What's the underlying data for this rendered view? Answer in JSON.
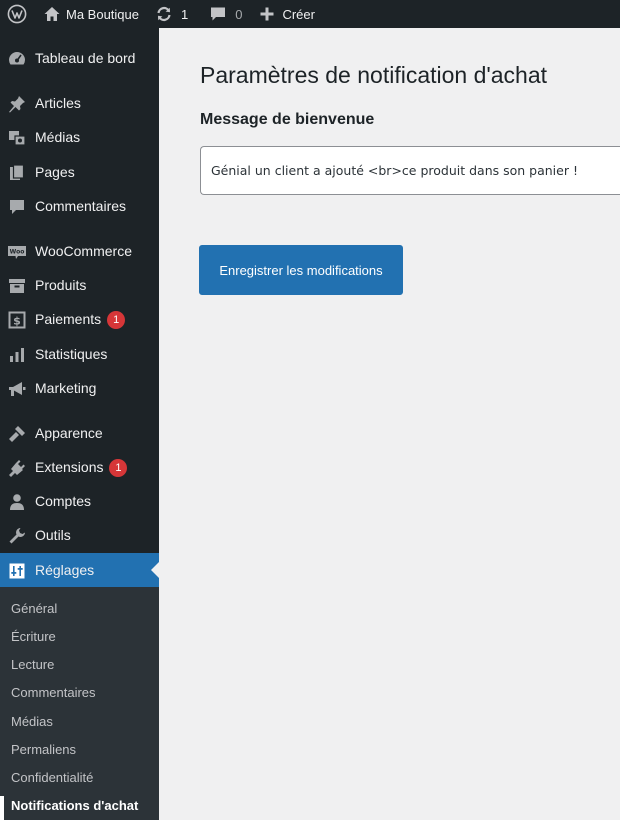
{
  "admin_bar": {
    "site_name": "Ma Boutique",
    "updates_count": "1",
    "comments_count": "0",
    "new_label": "Créer"
  },
  "sidebar": {
    "items": [
      {
        "label": "Tableau de bord",
        "icon": "dashboard-icon"
      },
      {
        "label": "Articles",
        "icon": "pin-icon"
      },
      {
        "label": "Médias",
        "icon": "media-icon"
      },
      {
        "label": "Pages",
        "icon": "pages-icon"
      },
      {
        "label": "Commentaires",
        "icon": "comments-icon"
      },
      {
        "label": "WooCommerce",
        "icon": "woocommerce-icon"
      },
      {
        "label": "Produits",
        "icon": "products-icon"
      },
      {
        "label": "Paiements",
        "icon": "payments-icon",
        "badge": "1"
      },
      {
        "label": "Statistiques",
        "icon": "stats-icon"
      },
      {
        "label": "Marketing",
        "icon": "megaphone-icon"
      },
      {
        "label": "Apparence",
        "icon": "brush-icon"
      },
      {
        "label": "Extensions",
        "icon": "plugin-icon",
        "badge": "1"
      },
      {
        "label": "Comptes",
        "icon": "user-icon"
      },
      {
        "label": "Outils",
        "icon": "wrench-icon"
      },
      {
        "label": "Réglages",
        "icon": "settings-icon",
        "active": true
      }
    ],
    "submenu": [
      {
        "label": "Général"
      },
      {
        "label": "Écriture"
      },
      {
        "label": "Lecture"
      },
      {
        "label": "Commentaires"
      },
      {
        "label": "Médias"
      },
      {
        "label": "Permaliens"
      },
      {
        "label": "Confidentialité"
      },
      {
        "label": "Notifications d'achat",
        "current": true
      }
    ]
  },
  "main": {
    "title": "Paramètres de notification d'achat",
    "field_label": "Message de bienvenue",
    "field_value": "Génial un client a ajouté <br>ce produit dans son panier !",
    "save_label": "Enregistrer les modifications"
  },
  "colors": {
    "admin_dark": "#1d2327",
    "submenu_bg": "#2c3338",
    "accent": "#2271b1",
    "badge": "#d63638",
    "content_bg": "#f0f0f1"
  }
}
